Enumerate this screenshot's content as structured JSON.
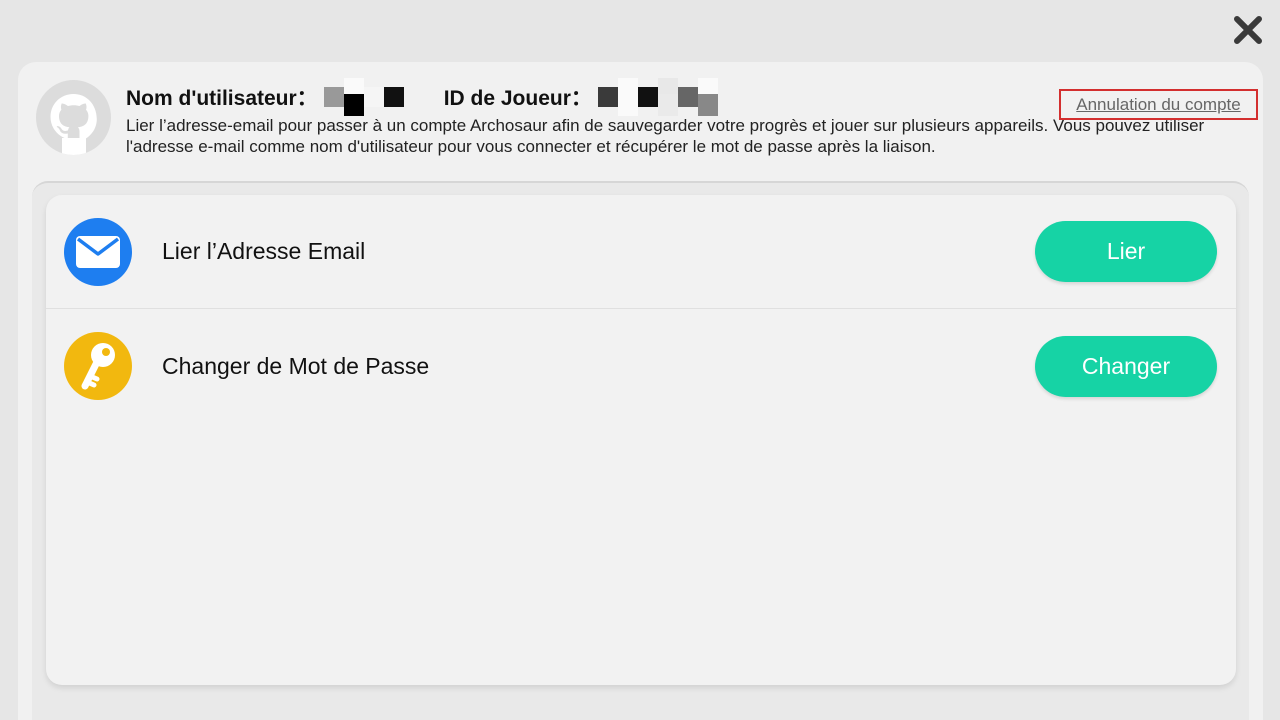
{
  "header": {
    "username_label": "Nom d'utilisateur：",
    "player_id_label": "ID de Joueur：",
    "description": "Lier l’adresse-email pour passer à un compte Archosaur afin de sauvegarder votre progrès et jouer sur plusieurs appareils. Vous pouvez utiliser l'adresse e-mail comme nom d'utilisateur pour vous connecter et récupérer le mot de passe après la liaison.",
    "cancel_account_label": "Annulation du compte"
  },
  "rows": [
    {
      "label": "Lier l’Adresse Email",
      "button": "Lier",
      "icon": "envelope-icon",
      "icon_color": "#1e7ef0"
    },
    {
      "label": "Changer de Mot de Passe",
      "button": "Changer",
      "icon": "key-icon",
      "icon_color": "#f2b80f"
    }
  ],
  "colors": {
    "accent": "#16d3a5",
    "highlight_border": "#d32f2f"
  }
}
